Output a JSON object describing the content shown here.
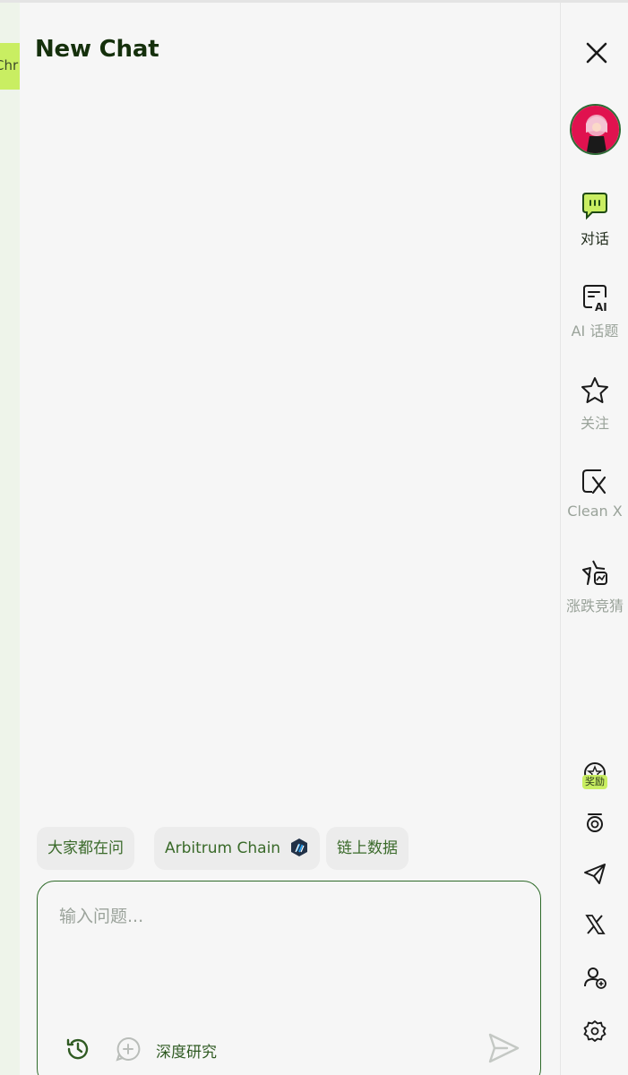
{
  "left_tab": {
    "label": "Chr"
  },
  "title": "New Chat",
  "sidebar": {
    "nav": [
      {
        "label": "对话",
        "icon": "chat-bubble-icon",
        "active": true
      },
      {
        "label": "AI 话题",
        "icon": "ai-topic-icon",
        "active": false
      },
      {
        "label": "关注",
        "icon": "star-icon",
        "active": false
      },
      {
        "label": "Clean X",
        "icon": "clean-x-icon",
        "active": false
      },
      {
        "label": "涨跌竞猜",
        "icon": "prediction-star-icon",
        "active": false
      }
    ],
    "reward_badge": "奖励",
    "bottom_icons": [
      "reward-icon",
      "medal-icon",
      "telegram-icon",
      "x-logo-icon",
      "add-user-icon",
      "gear-icon"
    ]
  },
  "chips": [
    {
      "label": "大家都在问"
    },
    {
      "label": "Arbitrum Chain",
      "icon": "arbitrum-icon"
    },
    {
      "label": "链上数据"
    }
  ],
  "input": {
    "placeholder": "输入问题...",
    "deep_research_label": "深度研究"
  },
  "colors": {
    "accent_lime": "#c9ee62",
    "dark_green": "#2f6b2a",
    "background": "#f6f6f6"
  }
}
